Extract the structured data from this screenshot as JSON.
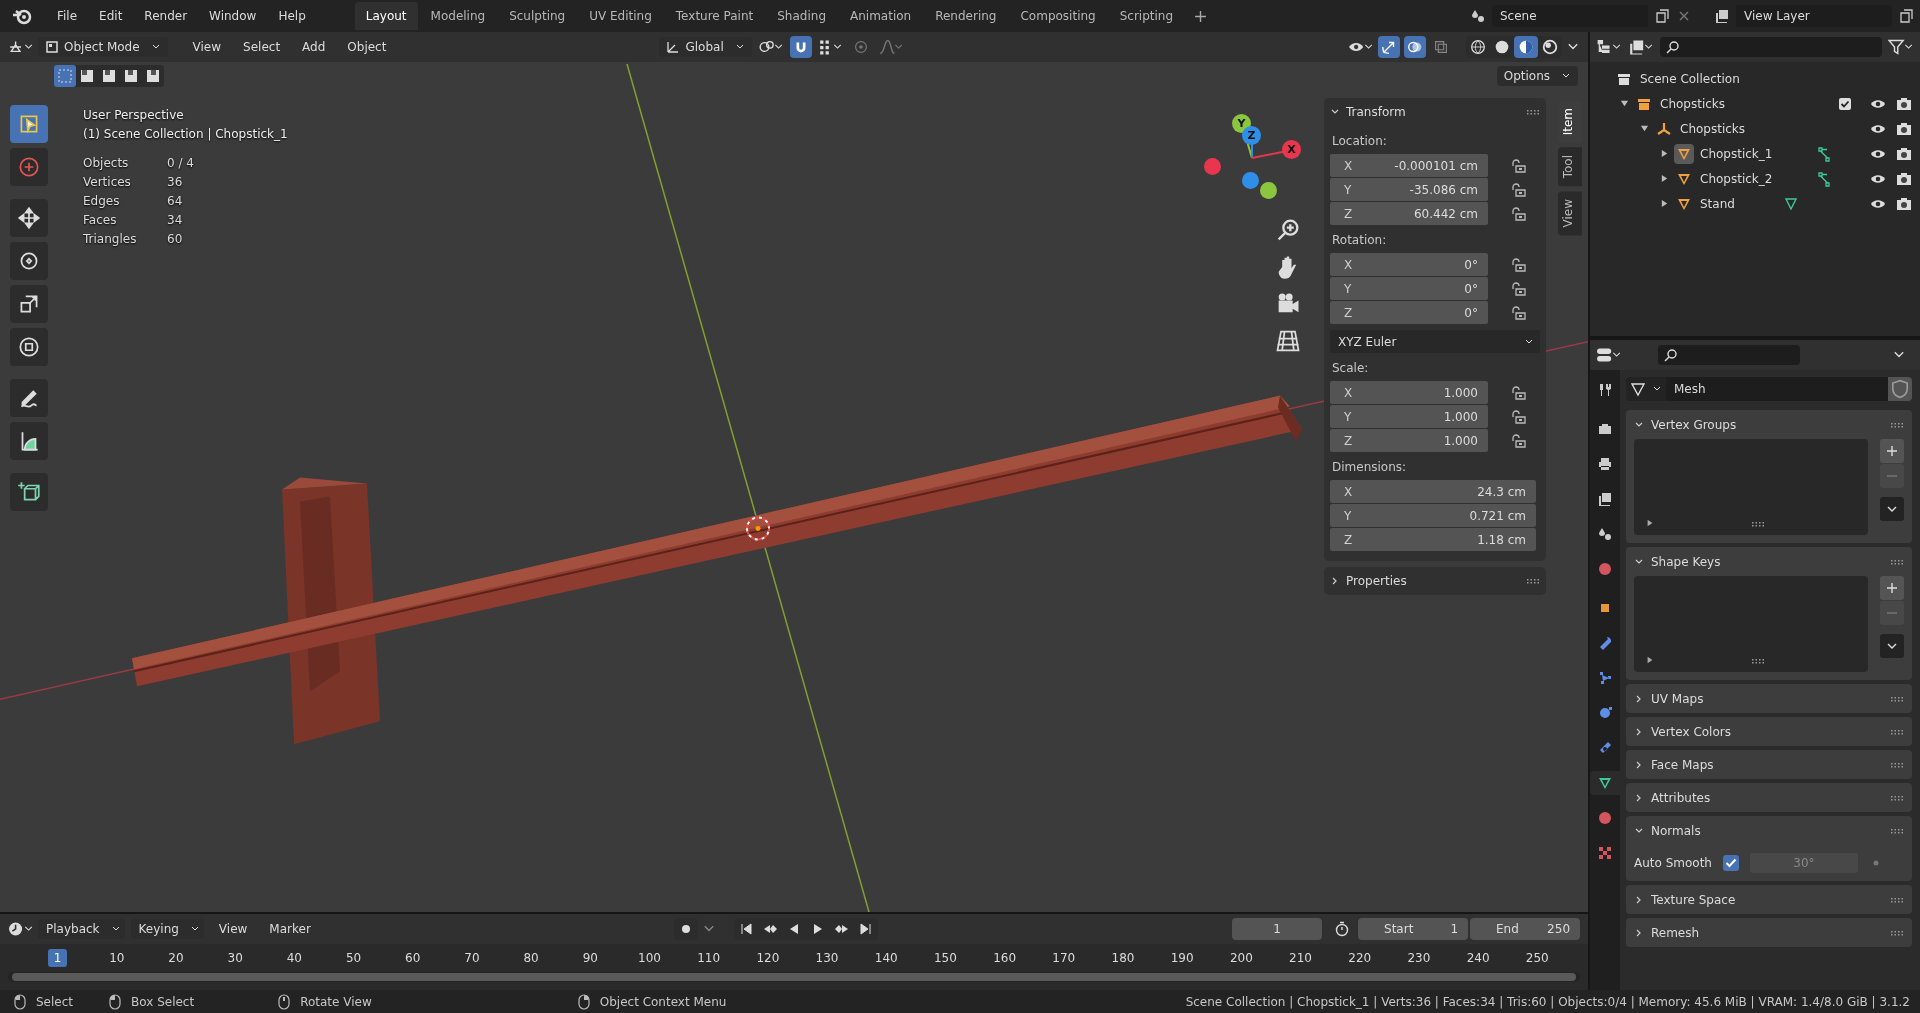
{
  "menu": [
    "File",
    "Edit",
    "Render",
    "Window",
    "Help"
  ],
  "workspaces": [
    {
      "label": "Layout",
      "selected": true
    },
    {
      "label": "Modeling",
      "selected": false
    },
    {
      "label": "Sculpting",
      "selected": false
    },
    {
      "label": "UV Editing",
      "selected": false
    },
    {
      "label": "Texture Paint",
      "selected": false
    },
    {
      "label": "Shading",
      "selected": false
    },
    {
      "label": "Animation",
      "selected": false
    },
    {
      "label": "Rendering",
      "selected": false
    },
    {
      "label": "Compositing",
      "selected": false
    },
    {
      "label": "Scripting",
      "selected": false
    }
  ],
  "scene": "Scene",
  "view_layer": "View Layer",
  "viewport": {
    "mode": "Object Mode",
    "menus": [
      "View",
      "Select",
      "Add",
      "Object"
    ],
    "orientation": "Global",
    "snap_on": true,
    "proportional_on": false,
    "gizmos_on": true,
    "overlays_on": true,
    "xray_on": false,
    "shading": [
      {
        "kind": "wireframe",
        "selected": false
      },
      {
        "kind": "solid",
        "selected": false
      },
      {
        "kind": "material",
        "selected": true
      },
      {
        "kind": "rendered",
        "selected": false
      }
    ],
    "select_modes": [
      {
        "selected": true
      },
      {
        "selected": false
      },
      {
        "selected": false
      },
      {
        "selected": false
      },
      {
        "selected": false
      }
    ],
    "options": "Options",
    "tools": [
      {
        "kind": "select",
        "selected": true
      },
      {
        "kind": "cursor",
        "selected": false
      },
      {
        "kind": "move",
        "selected": false
      },
      {
        "kind": "rotate",
        "selected": false
      },
      {
        "kind": "scale",
        "selected": false
      },
      {
        "kind": "transform",
        "selected": false
      },
      {
        "kind": "annotate",
        "selected": false
      },
      {
        "kind": "measure",
        "selected": false
      },
      {
        "kind": "add_cube",
        "selected": false
      }
    ],
    "title": "User Perspective",
    "context": "(1) Scene Collection | Chopstick_1",
    "stats": [
      {
        "label": "Objects",
        "value": "0 / 4"
      },
      {
        "label": "Vertices",
        "value": "36"
      },
      {
        "label": "Edges",
        "value": "64"
      },
      {
        "label": "Faces",
        "value": "34"
      },
      {
        "label": "Triangles",
        "value": "60"
      }
    ],
    "gizmo": [
      {
        "label": "Y",
        "color": "#8cc63e"
      },
      {
        "label": "Z",
        "color": "#2f8fe8"
      },
      {
        "label": "X",
        "color": "#e8364f"
      }
    ]
  },
  "n_panel": {
    "tabs": [
      {
        "label": "Item",
        "selected": true
      },
      {
        "label": "Tool",
        "selected": false
      },
      {
        "label": "View",
        "selected": false
      }
    ],
    "transform": {
      "title": "Transform",
      "expanded": true,
      "groups": [
        {
          "kind": "vector",
          "label": "Location:",
          "fields": [
            {
              "axis": "X",
              "value": "-0.000101 cm"
            },
            {
              "axis": "Y",
              "value": "-35.086 cm"
            },
            {
              "axis": "Z",
              "value": "60.442 cm"
            }
          ]
        },
        {
          "kind": "vector",
          "label": "Rotation:",
          "fields": [
            {
              "axis": "X",
              "value": "0°"
            },
            {
              "axis": "Y",
              "value": "0°"
            },
            {
              "axis": "Z",
              "value": "0°"
            }
          ]
        },
        {
          "kind": "dropdown",
          "value": "XYZ Euler"
        },
        {
          "kind": "vector",
          "label": "Scale:",
          "fields": [
            {
              "axis": "X",
              "value": "1.000"
            },
            {
              "axis": "Y",
              "value": "1.000"
            },
            {
              "axis": "Z",
              "value": "1.000"
            }
          ]
        },
        {
          "kind": "dimensions",
          "label": "Dimensions:",
          "fields": [
            {
              "axis": "X",
              "value": "24.3 cm"
            },
            {
              "axis": "Y",
              "value": "0.721 cm"
            },
            {
              "axis": "Z",
              "value": "1.18 cm"
            }
          ]
        }
      ]
    },
    "properties": {
      "title": "Properties",
      "expanded": false
    }
  },
  "outliner": {
    "tree": [
      {
        "name": "Scene Collection",
        "kind": "scene_collection",
        "selected": false,
        "children": [
          {
            "name": "Chopsticks",
            "kind": "collection",
            "expanded": true,
            "checked": true,
            "selected": false,
            "children": [
              {
                "name": "Chopsticks",
                "kind": "empty",
                "expanded": true,
                "selected": false,
                "children": [
                  {
                    "name": "Chopstick_1",
                    "kind": "mesh",
                    "data_icon": {
                      "kind": "edges"
                    },
                    "expanded": false,
                    "selected": true
                  },
                  {
                    "name": "Chopstick_2",
                    "kind": "mesh",
                    "data_icon": {
                      "kind": "edges"
                    },
                    "expanded": false,
                    "selected": false
                  },
                  {
                    "name": "Stand",
                    "kind": "mesh",
                    "data_icon": {
                      "kind": "mesh"
                    },
                    "expanded": false,
                    "selected": false
                  }
                ]
              }
            ]
          }
        ]
      }
    ]
  },
  "properties": {
    "tabs": [
      {
        "kind": "tool",
        "selected": false
      },
      {
        "kind": "render",
        "selected": false
      },
      {
        "kind": "output",
        "selected": false
      },
      {
        "kind": "view_layer",
        "selected": false
      },
      {
        "kind": "scene",
        "selected": false
      },
      {
        "kind": "world",
        "selected": false
      },
      {
        "kind": "object",
        "selected": false
      },
      {
        "kind": "modifiers",
        "selected": false
      },
      {
        "kind": "particles",
        "selected": false
      },
      {
        "kind": "physics",
        "selected": false
      },
      {
        "kind": "constraints",
        "selected": false
      },
      {
        "kind": "data",
        "selected": true
      },
      {
        "kind": "material",
        "selected": false
      },
      {
        "kind": "texture",
        "selected": false
      }
    ],
    "data_name": "Mesh",
    "panels": [
      {
        "kind": "list",
        "title": "Vertex Groups",
        "expanded": true
      },
      {
        "kind": "list",
        "title": "Shape Keys",
        "expanded": true
      },
      {
        "title": "UV Maps",
        "expanded": false
      },
      {
        "title": "Vertex Colors",
        "expanded": false
      },
      {
        "title": "Face Maps",
        "expanded": false
      },
      {
        "title": "Attributes",
        "expanded": false
      },
      {
        "kind": "normals",
        "title": "Normals",
        "expanded": true,
        "label": "Auto Smooth",
        "checked": true,
        "angle": "30°"
      },
      {
        "title": "Texture Space",
        "expanded": false
      },
      {
        "title": "Remesh",
        "expanded": false
      }
    ]
  },
  "timeline": {
    "menus": [
      {
        "label": "Playback",
        "dropdown": true
      },
      {
        "label": "Keying",
        "dropdown": true
      },
      {
        "label": "View",
        "dropdown": false
      },
      {
        "label": "Marker",
        "dropdown": false
      }
    ],
    "current_frame": "1",
    "start_label": "Start",
    "start": "1",
    "end_label": "End",
    "end": "250",
    "frames": [
      {
        "label": "1",
        "selected": true
      },
      {
        "label": "10",
        "selected": false
      },
      {
        "label": "20",
        "selected": false
      },
      {
        "label": "30",
        "selected": false
      },
      {
        "label": "40",
        "selected": false
      },
      {
        "label": "50",
        "selected": false
      },
      {
        "label": "60",
        "selected": false
      },
      {
        "label": "70",
        "selected": false
      },
      {
        "label": "80",
        "selected": false
      },
      {
        "label": "90",
        "selected": false
      },
      {
        "label": "100",
        "selected": false
      },
      {
        "label": "110",
        "selected": false
      },
      {
        "label": "120",
        "selected": false
      },
      {
        "label": "130",
        "selected": false
      },
      {
        "label": "140",
        "selected": false
      },
      {
        "label": "150",
        "selected": false
      },
      {
        "label": "160",
        "selected": false
      },
      {
        "label": "170",
        "selected": false
      },
      {
        "label": "180",
        "selected": false
      },
      {
        "label": "190",
        "selected": false
      },
      {
        "label": "200",
        "selected": false
      },
      {
        "label": "210",
        "selected": false
      },
      {
        "label": "220",
        "selected": false
      },
      {
        "label": "230",
        "selected": false
      },
      {
        "label": "240",
        "selected": false
      },
      {
        "label": "250",
        "selected": false
      }
    ]
  },
  "status_bar": {
    "hints": [
      {
        "kind": "left",
        "label": "Select"
      },
      {
        "kind": "drag",
        "label": "Box Select"
      },
      {
        "kind": "middle",
        "label": "Rotate View"
      },
      {
        "kind": "right",
        "label": "Object Context Menu"
      }
    ],
    "info": "Scene Collection | Chopstick_1 | Verts:36 | Faces:34 | Tris:60 | Objects:0/4 | Memory: 45.6 MiB | VRAM: 1.4/8.0 GiB | 3.1.2"
  }
}
